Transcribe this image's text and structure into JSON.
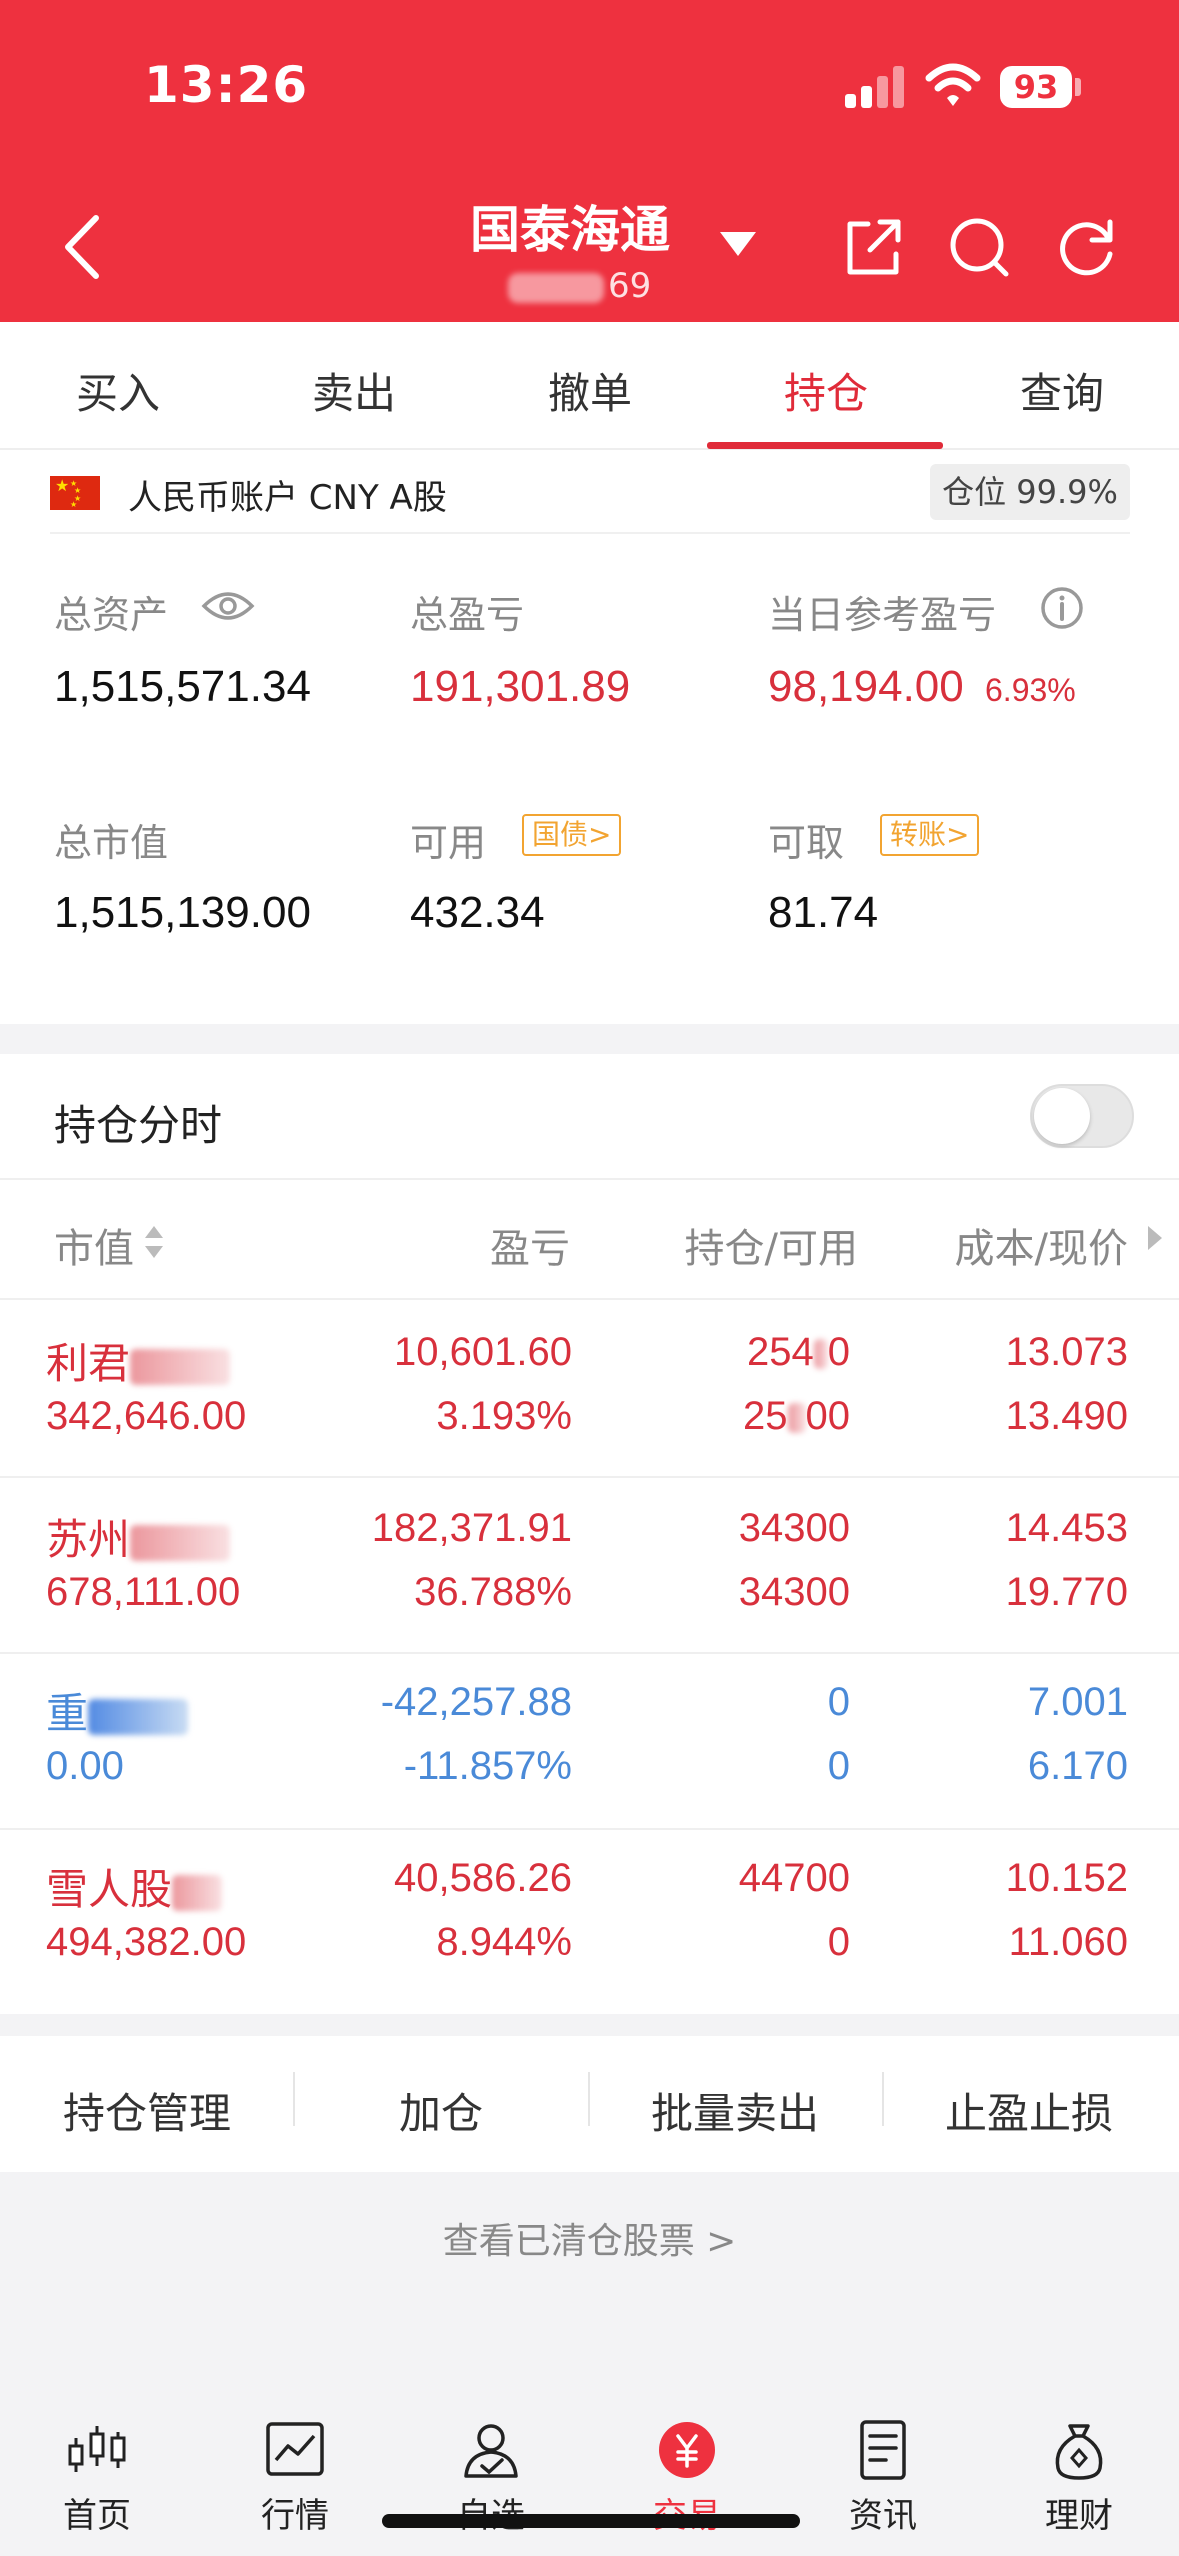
{
  "status_bar": {
    "time": "13:26",
    "battery": "93"
  },
  "header": {
    "title": "国泰海通",
    "account_suffix": "69"
  },
  "tabs": [
    {
      "label": "买入",
      "active": false
    },
    {
      "label": "卖出",
      "active": false
    },
    {
      "label": "撤单",
      "active": false
    },
    {
      "label": "持仓",
      "active": true
    },
    {
      "label": "查询",
      "active": false
    }
  ],
  "account": {
    "label": "人民币账户 CNY A股",
    "position_ratio": "仓位 99.9%",
    "total_assets_label": "总资产",
    "total_assets": "1,515,571.34",
    "total_pnl_label": "总盈亏",
    "total_pnl": "191,301.89",
    "daily_pnl_label": "当日参考盈亏",
    "daily_pnl": "98,194.00",
    "daily_pnl_pct": "6.93%",
    "market_value_label": "总市值",
    "market_value": "1,515,139.00",
    "available_label": "可用",
    "available": "432.34",
    "available_chip": "国债>",
    "withdrawable_label": "可取",
    "withdrawable": "81.74",
    "withdrawable_chip": "转账>"
  },
  "holdings": {
    "section_title": "持仓分时",
    "columns": {
      "market_value": "市值",
      "pnl": "盈亏",
      "position": "持仓/可用",
      "cost_price": "成本/现价"
    },
    "rows": [
      {
        "name": "利君",
        "value": "342,646.00",
        "pnl": "10,601.60",
        "pnl_pct": "3.193%",
        "position": "254",
        "position_tail": "0",
        "available": "25",
        "available_tail": "00",
        "cost": "13.073",
        "price": "13.490",
        "color": "red"
      },
      {
        "name": "苏州",
        "value": "678,111.00",
        "pnl": "182,371.91",
        "pnl_pct": "36.788%",
        "position": "34300",
        "position_tail": "",
        "available": "34300",
        "available_tail": "",
        "cost": "14.453",
        "price": "19.770",
        "color": "red"
      },
      {
        "name": "重",
        "value": "0.00",
        "pnl": "-42,257.88",
        "pnl_pct": "-11.857%",
        "position": "0",
        "position_tail": "",
        "available": "0",
        "available_tail": "",
        "cost": "7.001",
        "price": "6.170",
        "color": "blue"
      },
      {
        "name": "雪人股",
        "value": "494,382.00",
        "pnl": "40,586.26",
        "pnl_pct": "8.944%",
        "position": "44700",
        "position_tail": "",
        "available": "0",
        "available_tail": "",
        "cost": "10.152",
        "price": "11.060",
        "color": "red"
      }
    ]
  },
  "actions": [
    "持仓管理",
    "加仓",
    "批量卖出",
    "止盈止损"
  ],
  "cleared_link": "查看已清仓股票 >",
  "tabbar": [
    {
      "label": "首页",
      "icon": "candlestick-icon"
    },
    {
      "label": "行情",
      "icon": "chart-icon"
    },
    {
      "label": "自选",
      "icon": "person-check-icon"
    },
    {
      "label": "交易",
      "icon": "yuan-icon",
      "active": true
    },
    {
      "label": "资讯",
      "icon": "document-icon"
    },
    {
      "label": "理财",
      "icon": "money-bag-icon"
    }
  ],
  "colors": {
    "brand_red": "#ee313f",
    "gain_red": "#d8303c",
    "loss_blue": "#4a8ad8",
    "chip_orange": "#f2a431"
  }
}
